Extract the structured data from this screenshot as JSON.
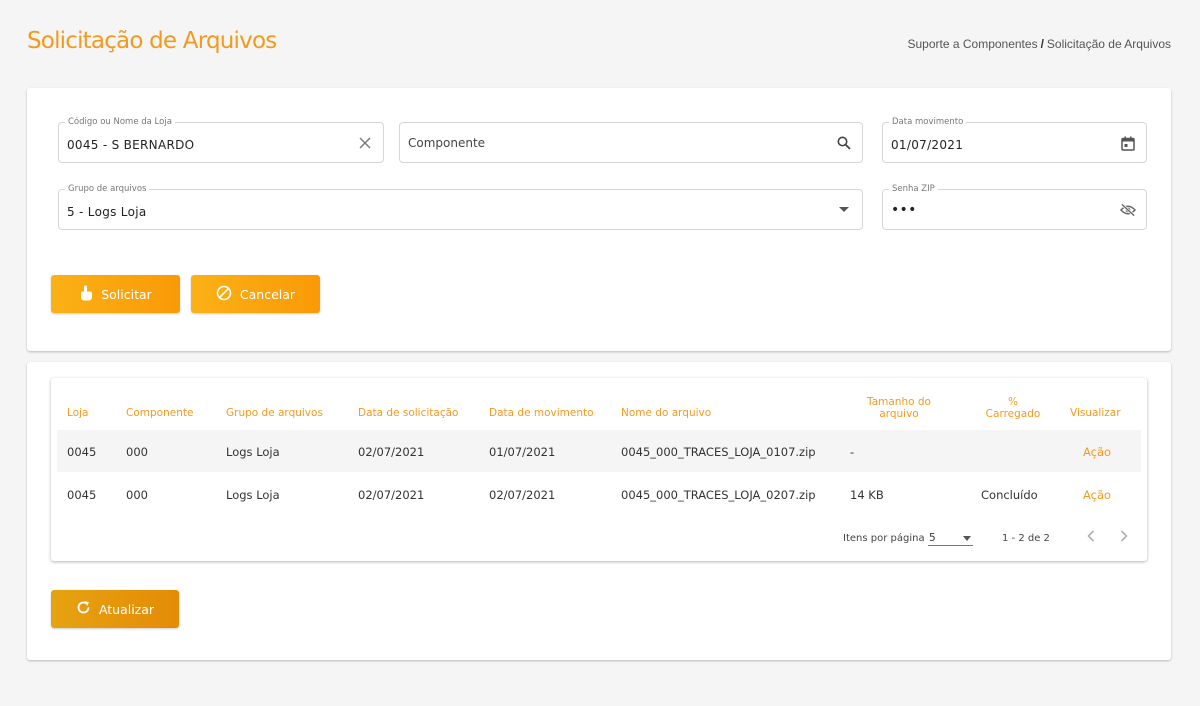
{
  "header": {
    "title": "Solicitação de Arquivos",
    "breadcrumb": {
      "parent": "Suporte a Componentes",
      "separator": "/",
      "current": "Solicitação de Arquivos"
    }
  },
  "form": {
    "loja": {
      "label": "Código ou Nome da Loja",
      "value": "0045 - S BERNARDO",
      "icon": "close-icon"
    },
    "componente": {
      "placeholder": "Componente",
      "icon": "search-icon"
    },
    "data_movimento": {
      "label": "Data movimento",
      "value": "01/07/2021",
      "icon": "calendar-icon"
    },
    "grupo": {
      "label": "Grupo de arquivos",
      "value": "5 - Logs Loja",
      "icon": "dropdown-arrow-icon"
    },
    "senha": {
      "label": "Senha ZIP",
      "value": "•••",
      "icon": "eye-off-icon"
    },
    "buttons": {
      "solicitar": "Solicitar",
      "cancelar": "Cancelar"
    }
  },
  "table": {
    "columns": {
      "loja": "Loja",
      "componente": "Componente",
      "grupo": "Grupo de arquivos",
      "data_solicitacao": "Data de solicitação",
      "data_movimento": "Data de movimento",
      "nome_arquivo": "Nome do arquivo",
      "tamanho_l1": "Tamanho do",
      "tamanho_l2": "arquivo",
      "carregado_l1": "%",
      "carregado_l2": "Carregado",
      "visualizar": "Visualizar"
    },
    "rows": [
      {
        "loja": "0045",
        "componente": "000",
        "grupo": "Logs Loja",
        "data_solicitacao": "02/07/2021",
        "data_movimento": "01/07/2021",
        "nome_arquivo": "0045_000_TRACES_LOJA_0107.zip",
        "tamanho": "-",
        "carregado": "",
        "acao": "Ação"
      },
      {
        "loja": "0045",
        "componente": "000",
        "grupo": "Logs Loja",
        "data_solicitacao": "02/07/2021",
        "data_movimento": "02/07/2021",
        "nome_arquivo": "0045_000_TRACES_LOJA_0207.zip",
        "tamanho": "14 KB",
        "carregado": "Concluído",
        "acao": "Ação"
      }
    ],
    "paginator": {
      "items_label": "Itens por página",
      "page_size": "5",
      "range": "1 - 2 de 2"
    }
  },
  "actions": {
    "atualizar": "Atualizar"
  },
  "colors": {
    "accent": "#f39a1e",
    "button_start": "#fbb116",
    "button_end": "#f99a06"
  }
}
